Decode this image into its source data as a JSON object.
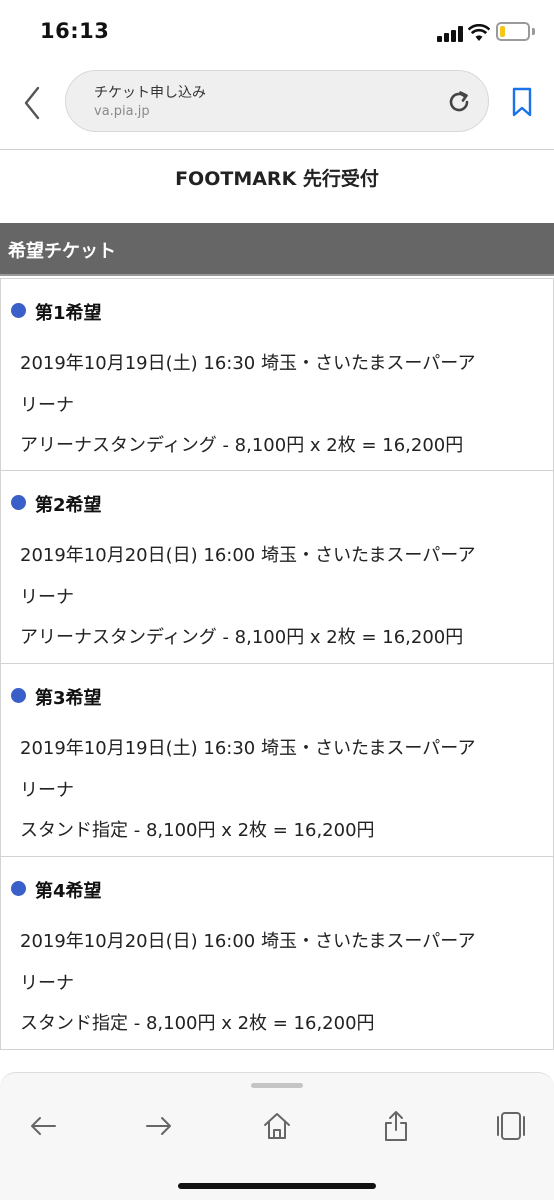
{
  "status_bar": {
    "time": "16:13",
    "battery_level": 0.2
  },
  "browser": {
    "page_title": "チケット申し込み",
    "domain": "va.pia.jp"
  },
  "page": {
    "title": "FOOTMARK 先行受付",
    "section_header": "希望チケット",
    "choices": [
      {
        "label": "第1希望",
        "line1": "2019年10月19日(土) 16:30 埼玉・さいたまスーパーア",
        "line2": "リーナ",
        "line3": "アリーナスタンディング - 8,100円 x 2枚 = 16,200円"
      },
      {
        "label": "第2希望",
        "line1": "2019年10月20日(日) 16:00 埼玉・さいたまスーパーア",
        "line2": "リーナ",
        "line3": "アリーナスタンディング - 8,100円 x 2枚 = 16,200円"
      },
      {
        "label": "第3希望",
        "line1": "2019年10月19日(土) 16:30 埼玉・さいたまスーパーア",
        "line2": "リーナ",
        "line3": "スタンド指定 - 8,100円 x 2枚 = 16,200円"
      },
      {
        "label": "第4希望",
        "line1": "2019年10月20日(日) 16:00 埼玉・さいたまスーパーア",
        "line2": "リーナ",
        "line3": "スタンド指定 - 8,100円 x 2枚 = 16,200円"
      }
    ]
  },
  "colors": {
    "accent": "#3a5fc8",
    "section_header_bg": "#666666",
    "link_blue": "#1a73e8"
  },
  "toolbar_icons": [
    "back-arrow-icon",
    "forward-arrow-icon",
    "home-icon",
    "share-icon",
    "tabs-icon"
  ]
}
